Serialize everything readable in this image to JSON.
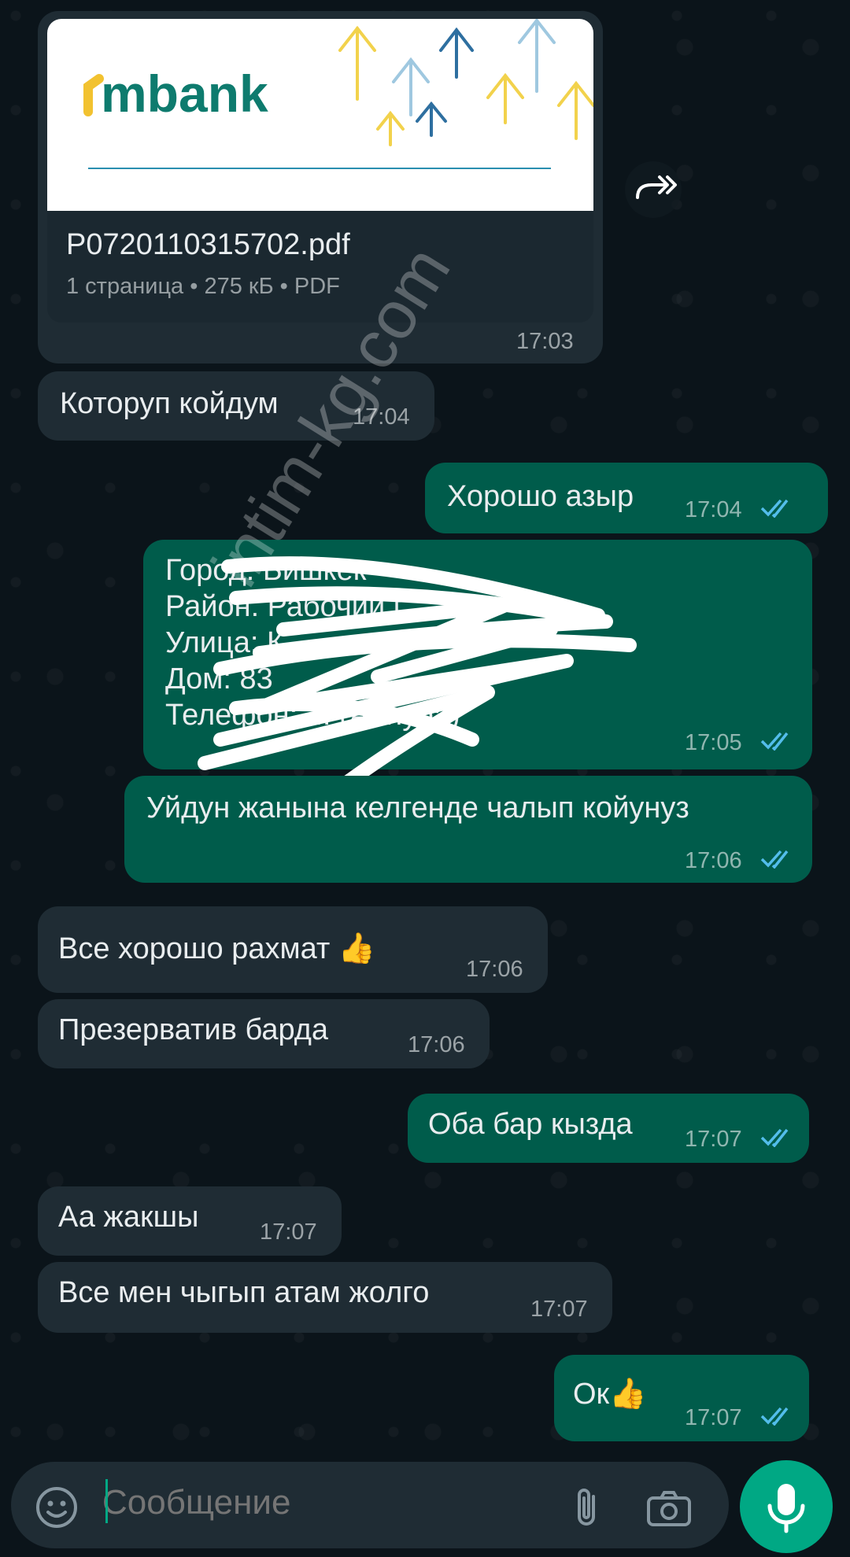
{
  "document": {
    "brand": "mbank",
    "filename": "P0720110315702.pdf",
    "meta": "1 страница • 275 кБ • PDF",
    "time": "17:03"
  },
  "messages": [
    {
      "text": "Которуп койдум",
      "time": "17:04",
      "direction": "incoming"
    },
    {
      "text": "Хорошо азыр",
      "time": "17:04",
      "direction": "outgoing",
      "status": "read"
    },
    {
      "lines": [
        "Город: Бишкек",
        "Район: Рабочий г...",
        "Улица: К...",
        "Дом: 83",
        "Телефон: ... (Айнура)"
      ],
      "time": "17:05",
      "direction": "outgoing",
      "status": "read",
      "redacted": true
    },
    {
      "text": "Уйдун жанына келгенде чалып койунуз",
      "time": "17:06",
      "direction": "outgoing",
      "status": "read"
    },
    {
      "text": "Все хорошо рахмат 👍",
      "time": "17:06",
      "direction": "incoming"
    },
    {
      "text": "Презерватив барда",
      "time": "17:06",
      "direction": "incoming"
    },
    {
      "text": "Оба бар кызда",
      "time": "17:07",
      "direction": "outgoing",
      "status": "read"
    },
    {
      "text": "Аа жакшы",
      "time": "17:07",
      "direction": "incoming"
    },
    {
      "text": "Все мен чыгып атам жолго",
      "time": "17:07",
      "direction": "incoming"
    },
    {
      "text": "Ок👍",
      "time": "17:07",
      "direction": "outgoing",
      "status": "read"
    }
  ],
  "composer": {
    "placeholder": "Сообщение"
  },
  "watermark": "intim-kg.com",
  "icons": {
    "forward": "forward-icon",
    "read_receipt": "double-check-icon",
    "emoji": "emoji-icon",
    "attach": "paperclip-icon",
    "camera": "camera-icon",
    "mic": "mic-icon"
  },
  "colors": {
    "background": "#0b141a",
    "incoming_bubble": "#1f2c34",
    "outgoing_bubble": "#005c4b",
    "read_tick": "#53bdeb",
    "accent": "#00a884"
  }
}
